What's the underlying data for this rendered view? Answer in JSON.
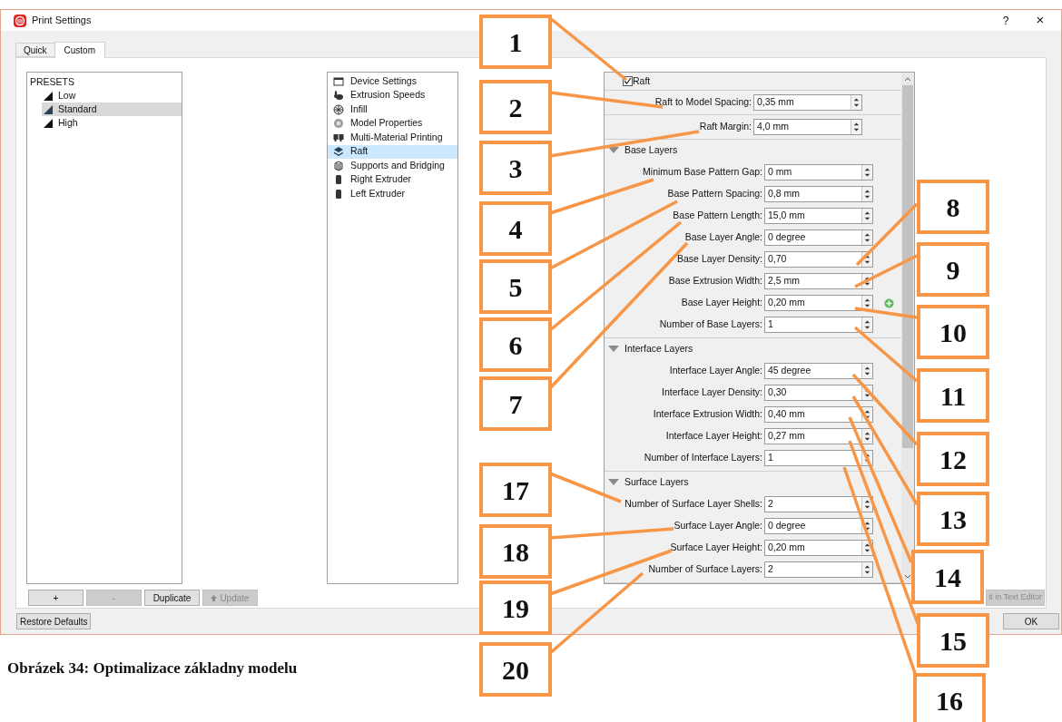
{
  "window": {
    "title": "Print Settings",
    "help": "?",
    "close": "×"
  },
  "tabs": [
    {
      "label": "Quick",
      "selected": false
    },
    {
      "label": "Custom",
      "selected": true
    }
  ],
  "presets": {
    "heading": "PRESETS",
    "items": [
      {
        "label": "Low",
        "selected": false
      },
      {
        "label": "Standard",
        "selected": true
      },
      {
        "label": "High",
        "selected": false
      }
    ]
  },
  "preset_buttons": [
    {
      "label": "+",
      "disabled": false
    },
    {
      "label": "-",
      "disabled": true
    },
    {
      "label": "Duplicate",
      "disabled": false
    },
    {
      "label": "Update",
      "disabled": true
    }
  ],
  "categories": [
    {
      "label": "Device Settings",
      "selected": false
    },
    {
      "label": "Extrusion Speeds",
      "selected": false
    },
    {
      "label": "Infill",
      "selected": false
    },
    {
      "label": "Model Properties",
      "selected": false
    },
    {
      "label": "Multi-Material Printing",
      "selected": false
    },
    {
      "label": "Raft",
      "selected": true
    },
    {
      "label": "Supports and Bridging",
      "selected": false
    },
    {
      "label": "Right Extruder",
      "selected": false
    },
    {
      "label": "Left Extruder",
      "selected": false
    }
  ],
  "settings": [
    {
      "kind": "checkbox",
      "label": "Raft",
      "checked": true
    },
    {
      "kind": "field",
      "label": "Raft to Model Spacing:",
      "value": "0,35 mm"
    },
    {
      "kind": "field",
      "label": "Raft Margin:",
      "value": "4,0 mm"
    },
    {
      "kind": "section",
      "label": "Base Layers",
      "expanded": true,
      "fields": [
        {
          "label": "Minimum Base Pattern Gap:",
          "value": "0 mm",
          "marked": false
        },
        {
          "label": "Base Pattern Spacing:",
          "value": "0,8 mm",
          "marked": false
        },
        {
          "label": "Base Pattern Length:",
          "value": "15,0 mm",
          "marked": false
        },
        {
          "label": "Base Layer Angle:",
          "value": "0 degree",
          "marked": false
        },
        {
          "label": "Base Layer Density:",
          "value": "0,70",
          "marked": false
        },
        {
          "label": "Base Extrusion Width:",
          "value": "2,5 mm",
          "marked": false
        },
        {
          "label": "Base Layer Height:",
          "value": "0,20 mm",
          "marked": true
        },
        {
          "label": "Number of Base Layers:",
          "value": "1",
          "marked": false
        }
      ]
    },
    {
      "kind": "section",
      "label": "Interface Layers",
      "expanded": true,
      "fields": [
        {
          "label": "Interface Layer Angle:",
          "value": "45 degree",
          "marked": false
        },
        {
          "label": "Interface Layer Density:",
          "value": "0,30",
          "marked": false
        },
        {
          "label": "Interface Extrusion Width:",
          "value": "0,40 mm",
          "marked": false
        },
        {
          "label": "Interface Layer Height:",
          "value": "0,27 mm",
          "marked": false
        },
        {
          "label": "Number of Interface Layers:",
          "value": "1",
          "marked": false
        }
      ]
    },
    {
      "kind": "section",
      "label": "Surface Layers",
      "expanded": true,
      "fields": [
        {
          "label": "Number of Surface Layer Shells:",
          "value": "2",
          "marked": false
        },
        {
          "label": "Surface Layer Angle:",
          "value": "0 degree",
          "marked": false
        },
        {
          "label": "Surface Layer Height:",
          "value": "0,20 mm",
          "marked": false
        },
        {
          "label": "Number of Surface Layers:",
          "value": "2",
          "marked": false
        }
      ]
    }
  ],
  "edit_button": {
    "label": "it in Text Editor",
    "disabled": true
  },
  "footer_buttons": [
    {
      "label": "Restore Defaults"
    },
    {
      "label": "OK"
    }
  ],
  "callouts_left": [
    {
      "label": "1"
    },
    {
      "label": "2"
    },
    {
      "label": "3"
    },
    {
      "label": "4"
    },
    {
      "label": "5"
    },
    {
      "label": "6"
    },
    {
      "label": "7"
    },
    {
      "label": "17"
    },
    {
      "label": "18"
    },
    {
      "label": "19"
    },
    {
      "label": "20"
    }
  ],
  "callouts_right": [
    {
      "label": "8"
    },
    {
      "label": "9"
    },
    {
      "label": "10"
    },
    {
      "label": "11"
    },
    {
      "label": "12"
    },
    {
      "label": "13"
    },
    {
      "label": "14"
    },
    {
      "label": "15"
    },
    {
      "label": "16"
    }
  ],
  "caption": "Obrázek 34: Optimalizace základny modelu"
}
